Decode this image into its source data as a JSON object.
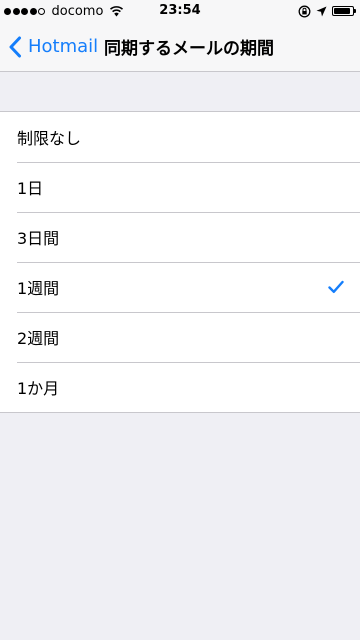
{
  "status_bar": {
    "carrier": "docomo",
    "time": "23:54",
    "signal_bars": 4,
    "signal_total": 5,
    "battery_level": 0.9
  },
  "nav": {
    "back_label": "Hotmail",
    "title": "同期するメールの期間"
  },
  "options": [
    {
      "label": "制限なし",
      "selected": false
    },
    {
      "label": "1日",
      "selected": false
    },
    {
      "label": "3日間",
      "selected": false
    },
    {
      "label": "1週間",
      "selected": true
    },
    {
      "label": "2週間",
      "selected": false
    },
    {
      "label": "1か月",
      "selected": false
    }
  ],
  "colors": {
    "accent": "#157efb",
    "background": "#efeff4"
  },
  "icons": {
    "back": "chevron-left-icon",
    "selected": "checkmark-icon",
    "wifi": "wifi-icon",
    "orientation_lock": "orientation-lock-icon",
    "location": "location-arrow-icon",
    "battery": "battery-icon"
  }
}
